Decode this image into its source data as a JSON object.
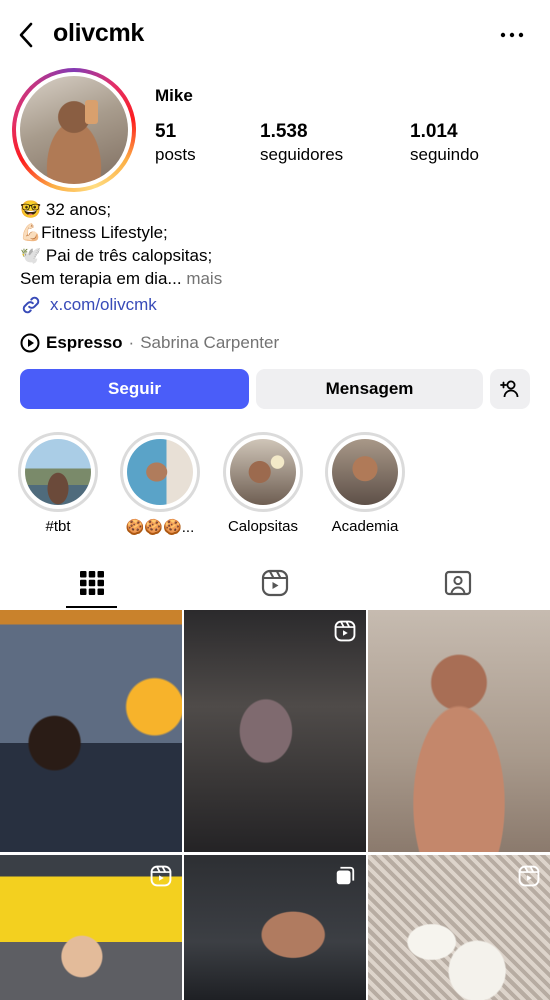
{
  "header": {
    "username": "olivcmk"
  },
  "profile": {
    "display_name": "Mike",
    "stats": [
      {
        "value": "51",
        "label": "posts"
      },
      {
        "value": "1.538",
        "label": "seguidores"
      },
      {
        "value": "1.014",
        "label": "seguindo"
      }
    ],
    "bio": [
      "🤓 32 anos;",
      "💪🏻Fitness Lifestyle;",
      "🕊️ Pai de três calopsitas;",
      "Sem terapia em dia..."
    ],
    "bio_more": "mais",
    "link": "x.com/olivcmk",
    "music": {
      "song": "Espresso",
      "separator": "·",
      "artist": "Sabrina Carpenter"
    }
  },
  "actions": {
    "follow_label": "Seguir",
    "message_label": "Mensagem",
    "add_user_icon": "person-add-icon"
  },
  "highlights": [
    {
      "label": "#tbt"
    },
    {
      "label": "🍪🍪🍪..."
    },
    {
      "label": "Calopsitas"
    },
    {
      "label": "Academia"
    }
  ],
  "tabs": [
    {
      "name": "posts-grid-icon",
      "active": true
    },
    {
      "name": "reels-icon",
      "active": false
    },
    {
      "name": "tagged-icon",
      "active": false
    }
  ],
  "grid": [
    {
      "type": "photo"
    },
    {
      "type": "reel"
    },
    {
      "type": "photo"
    },
    {
      "type": "reel"
    },
    {
      "type": "carousel"
    },
    {
      "type": "reel"
    }
  ],
  "colors": {
    "follow_button": "#4a5df9",
    "secondary_button": "#efeff1",
    "link": "#384bb8",
    "muted_text": "#737373"
  }
}
